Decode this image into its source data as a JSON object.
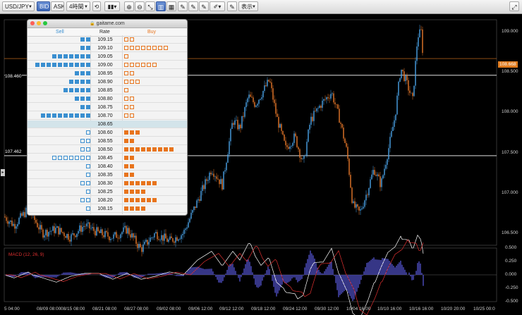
{
  "toolbar": {
    "symbol": "USD/JPY",
    "bid": "BID",
    "ask": "ASK",
    "timeframe": "4時間",
    "display": "表示",
    "colors": {
      "active": "#3c67b6"
    }
  },
  "orderbook": {
    "site": "gaitame.com",
    "sell_label": "Sell",
    "rate_label": "Rate",
    "buy_label": "Buy",
    "current_rate": "108.65",
    "rows": [
      {
        "rate": "109.15",
        "sell_filled": 2,
        "sell_empty": 0,
        "buy_filled": 0,
        "buy_empty": 2
      },
      {
        "rate": "109.10",
        "sell_filled": 2,
        "sell_empty": 0,
        "buy_filled": 0,
        "buy_empty": 8
      },
      {
        "rate": "109.05",
        "sell_filled": 7,
        "sell_empty": 0,
        "buy_filled": 0,
        "buy_empty": 1
      },
      {
        "rate": "109.00",
        "sell_filled": 10,
        "sell_empty": 0,
        "buy_filled": 0,
        "buy_empty": 6
      },
      {
        "rate": "108.95",
        "sell_filled": 3,
        "sell_empty": 0,
        "buy_filled": 0,
        "buy_empty": 2
      },
      {
        "rate": "108.90",
        "sell_filled": 4,
        "sell_empty": 0,
        "buy_filled": 0,
        "buy_empty": 3
      },
      {
        "rate": "108.85",
        "sell_filled": 5,
        "sell_empty": 0,
        "buy_filled": 0,
        "buy_empty": 1
      },
      {
        "rate": "108.80",
        "sell_filled": 3,
        "sell_empty": 0,
        "buy_filled": 0,
        "buy_empty": 2
      },
      {
        "rate": "108.75",
        "sell_filled": 2,
        "sell_empty": 0,
        "buy_filled": 0,
        "buy_empty": 2
      },
      {
        "rate": "108.70",
        "sell_filled": 9,
        "sell_empty": 0,
        "buy_filled": 0,
        "buy_empty": 2
      },
      {
        "rate": "108.65",
        "sell_filled": 0,
        "sell_empty": 0,
        "buy_filled": 0,
        "buy_empty": 0
      },
      {
        "rate": "108.60",
        "sell_filled": 0,
        "sell_empty": 1,
        "buy_filled": 3,
        "buy_empty": 0
      },
      {
        "rate": "108.55",
        "sell_filled": 0,
        "sell_empty": 2,
        "buy_filled": 2,
        "buy_empty": 0
      },
      {
        "rate": "108.50",
        "sell_filled": 0,
        "sell_empty": 2,
        "buy_filled": 9,
        "buy_empty": 0
      },
      {
        "rate": "108.45",
        "sell_filled": 0,
        "sell_empty": 7,
        "buy_filled": 2,
        "buy_empty": 0
      },
      {
        "rate": "108.40",
        "sell_filled": 0,
        "sell_empty": 1,
        "buy_filled": 2,
        "buy_empty": 0
      },
      {
        "rate": "108.35",
        "sell_filled": 0,
        "sell_empty": 1,
        "buy_filled": 2,
        "buy_empty": 0
      },
      {
        "rate": "108.30",
        "sell_filled": 0,
        "sell_empty": 2,
        "buy_filled": 6,
        "buy_empty": 0
      },
      {
        "rate": "108.25",
        "sell_filled": 0,
        "sell_empty": 1,
        "buy_filled": 4,
        "buy_empty": 0
      },
      {
        "rate": "108.20",
        "sell_filled": 0,
        "sell_empty": 2,
        "buy_filled": 6,
        "buy_empty": 0
      },
      {
        "rate": "108.15",
        "sell_filled": 0,
        "sell_empty": 1,
        "buy_filled": 4,
        "buy_empty": 0
      }
    ],
    "colors": {
      "sell": "#3a8fd0",
      "buy": "#e8741c"
    }
  },
  "chart": {
    "current_price": "108.668",
    "level_high": "108.460",
    "level_low": "107.462",
    "y_ticks": [
      "109.000",
      "108.500",
      "108.000",
      "107.500",
      "107.000",
      "106.500"
    ],
    "macd_label": "MACD (12, 26, 9)",
    "macd_ticks": [
      "0.500",
      "0.250",
      "0.000",
      "-0.250",
      "-0.500"
    ],
    "x_ticks": [
      "5 04:00",
      "08/09 08:00",
      "08/15 08:00",
      "08/21 08:00",
      "08/27 08:00",
      "09/02 08:00",
      "09/06 12:00",
      "09/12 12:00",
      "09/18 12:00",
      "09/24 12:00",
      "09/30 12:00",
      "10/04 16:00",
      "10/10 16:00",
      "10/16 16:00",
      "10/20 20:00",
      "10/25 00:0"
    ],
    "colors": {
      "up": "#4aa3e8",
      "down": "#e8782a",
      "price": "#e07b1e",
      "level": "#ffffff",
      "macd": "#ffffff",
      "signal": "#e03030",
      "histogram": "#5a5ae0"
    }
  }
}
